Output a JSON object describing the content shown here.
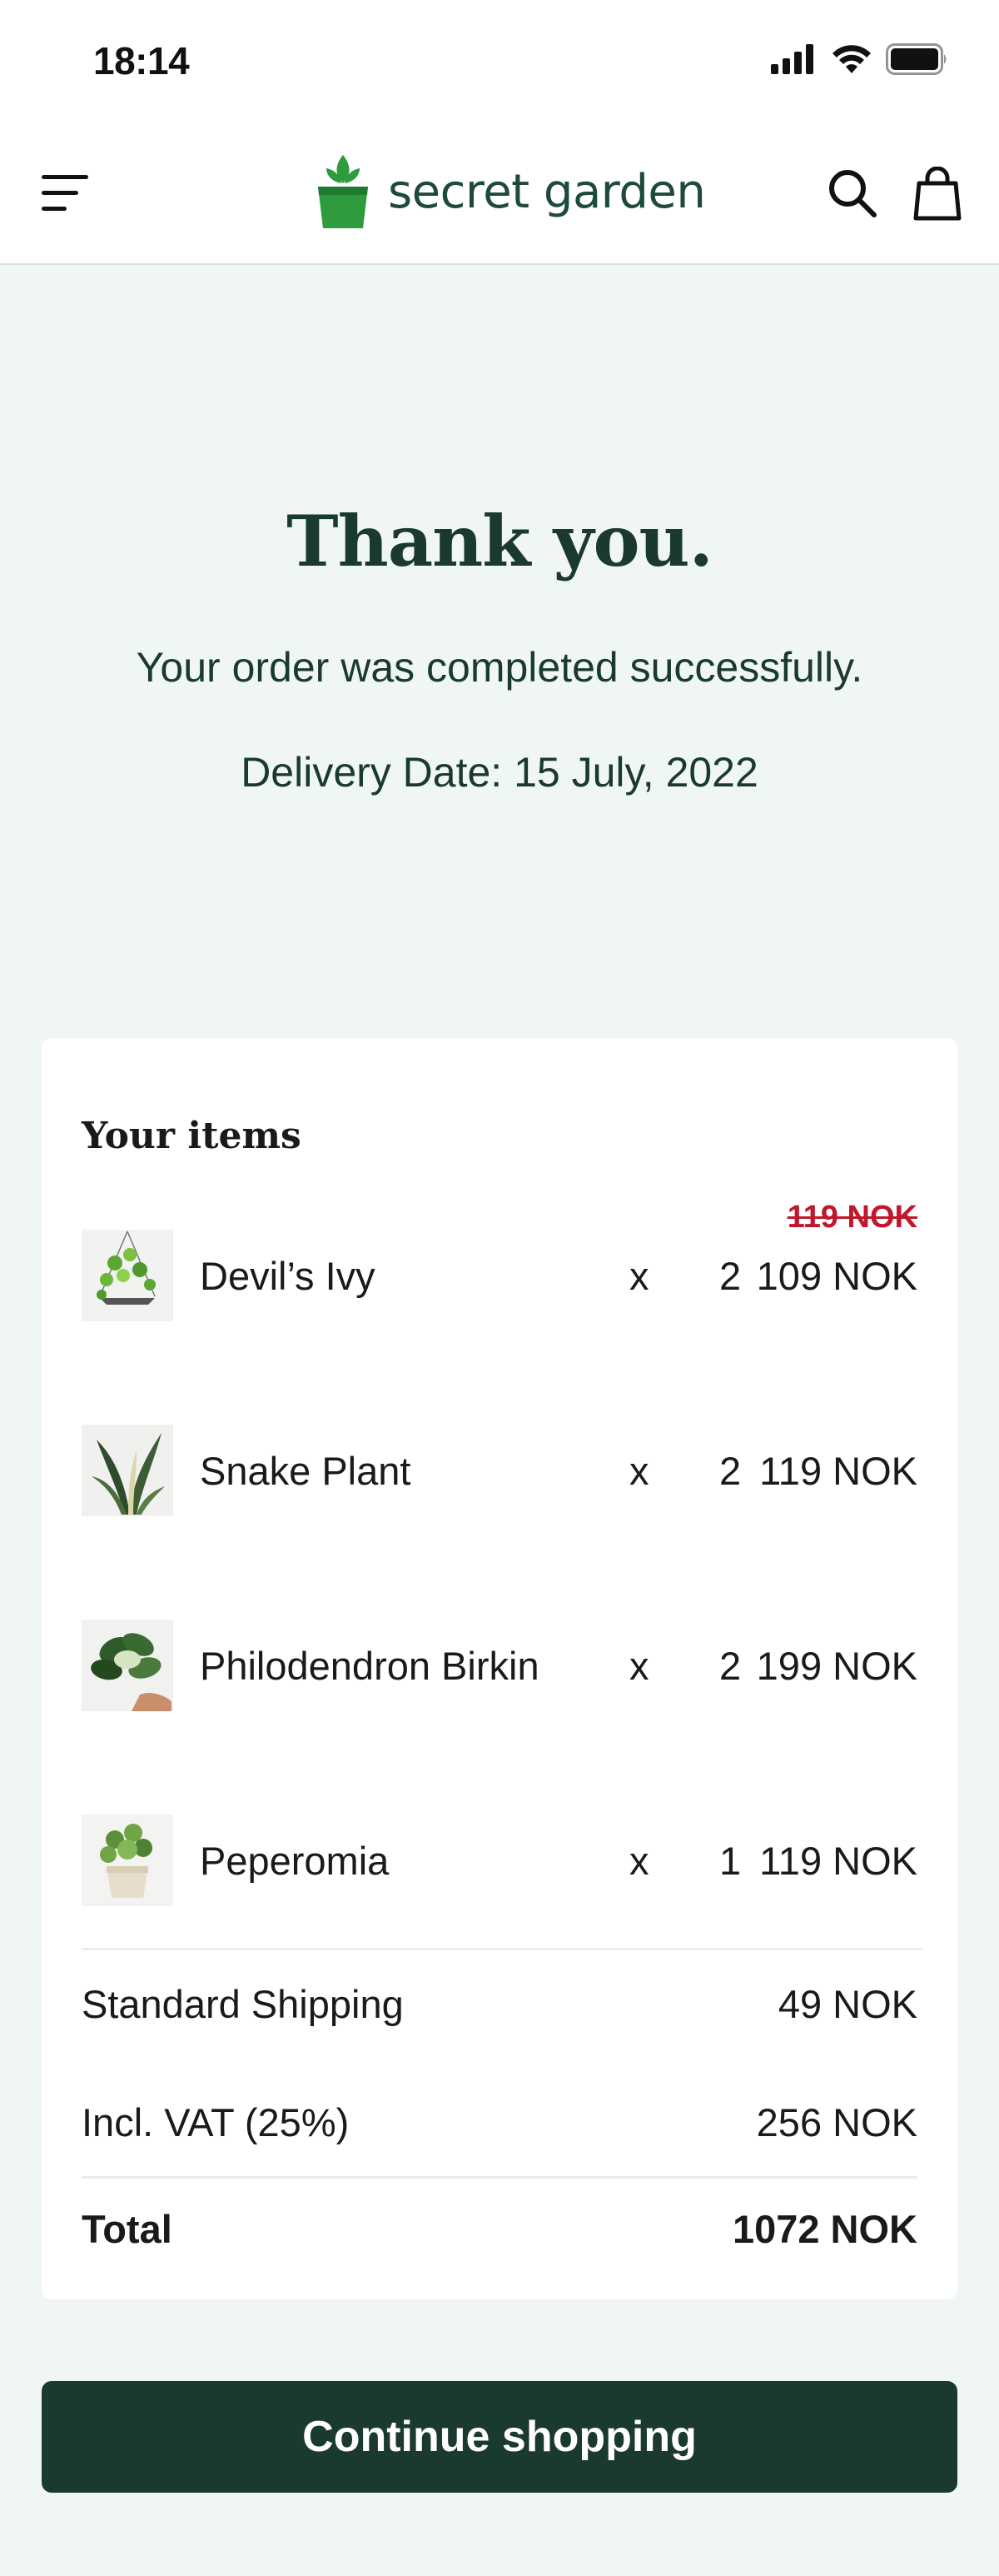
{
  "status": {
    "time": "18:14"
  },
  "header": {
    "brand": "secret garden"
  },
  "hero": {
    "title": "Thank you.",
    "subtitle": "Your order was completed successfully.",
    "delivery": "Delivery Date: 15 July, 2022"
  },
  "order": {
    "title": "Your items",
    "items": [
      {
        "name": "Devil’s Ivy",
        "x": "x",
        "qty": "2",
        "price": "109 NOK",
        "old_price": "119 NOK",
        "thumb": "hanging-ivy-plant"
      },
      {
        "name": "Snake Plant",
        "x": "x",
        "qty": "2",
        "price": "119 NOK",
        "thumb": "snake-plant"
      },
      {
        "name": "Philodendron Birkin",
        "x": "x",
        "qty": "2",
        "price": "199 NOK",
        "thumb": "philodendron-birkin"
      },
      {
        "name": "Peperomia",
        "x": "x",
        "qty": "1",
        "price": "119 NOK",
        "thumb": "peperomia-pot"
      }
    ],
    "shipping": {
      "label": "Standard Shipping",
      "value": "49 NOK"
    },
    "vat": {
      "label": "Incl. VAT (25%)",
      "value": "256 NOK"
    },
    "total": {
      "label": "Total",
      "value": "1072 NOK"
    }
  },
  "cta": {
    "label": "Continue shopping"
  },
  "colors": {
    "brand": "#1b3a2f",
    "logo_green": "#2e9b3e",
    "sale_red": "#c0172b",
    "page_bg": "#f0f7f3"
  }
}
